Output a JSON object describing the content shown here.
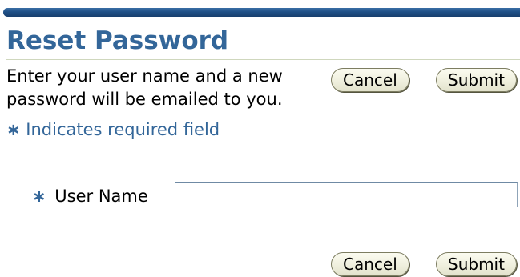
{
  "page": {
    "title": "Reset Password",
    "instructions": "Enter your user name and a new password will be emailed to you.",
    "required_marker": "∗",
    "required_note": "Indicates required field"
  },
  "actions_top": {
    "cancel_label": "Cancel",
    "submit_label": "Submit"
  },
  "form": {
    "user_name": {
      "label": "User Name",
      "value": "",
      "required": true
    }
  },
  "actions_bottom": {
    "cancel_label": "Cancel",
    "submit_label": "Submit"
  },
  "colors": {
    "header_bar": "#1f4f86",
    "title": "#336699",
    "required_note": "#336699",
    "button_face": "#eeeedc"
  }
}
